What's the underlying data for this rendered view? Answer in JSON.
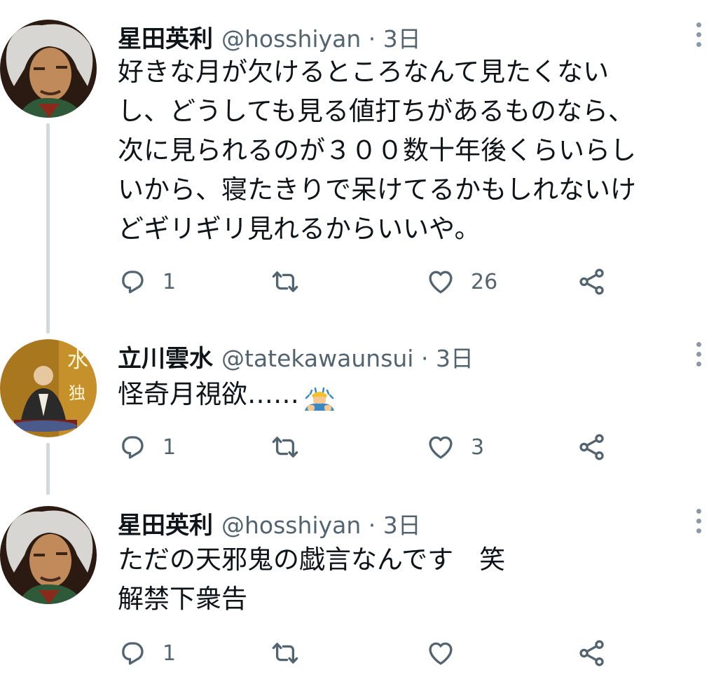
{
  "tweets": [
    {
      "name": "星田英利",
      "meta": "@hosshiyan · 3日",
      "lines": [
        "好きな月が欠けるところなんて見たくない",
        "し、どうしても見る値打ちがあるものなら、",
        "次に見られるのが３００数十年後くらいらし",
        "いから、寝たきりで呆けてるかもしれないけ",
        "どギリギリ見れるからいいや。"
      ],
      "reply_count": "1",
      "retweet_count": "",
      "like_count": "26"
    },
    {
      "name": "立川雲水",
      "meta": "@tatekawaunsui · 3日",
      "lines": [
        "怪奇月視欲……"
      ],
      "emoji": "man-bowing-emoji",
      "reply_count": "1",
      "retweet_count": "",
      "like_count": "3"
    },
    {
      "name": "星田英利",
      "meta": "@hosshiyan · 3日",
      "lines": [
        "ただの天邪鬼の戯言なんです　笑",
        "解禁下衆告"
      ],
      "reply_count": "1",
      "retweet_count": "",
      "like_count": ""
    }
  ],
  "icons": {
    "reply": "reply-icon",
    "retweet": "retweet-icon",
    "like": "heart-icon",
    "share": "share-icon",
    "more": "more-options-icon"
  },
  "colors": {
    "text": "#0f1419",
    "secondary": "#536471",
    "thread_line": "#cfd9de",
    "background": "#ffffff"
  }
}
